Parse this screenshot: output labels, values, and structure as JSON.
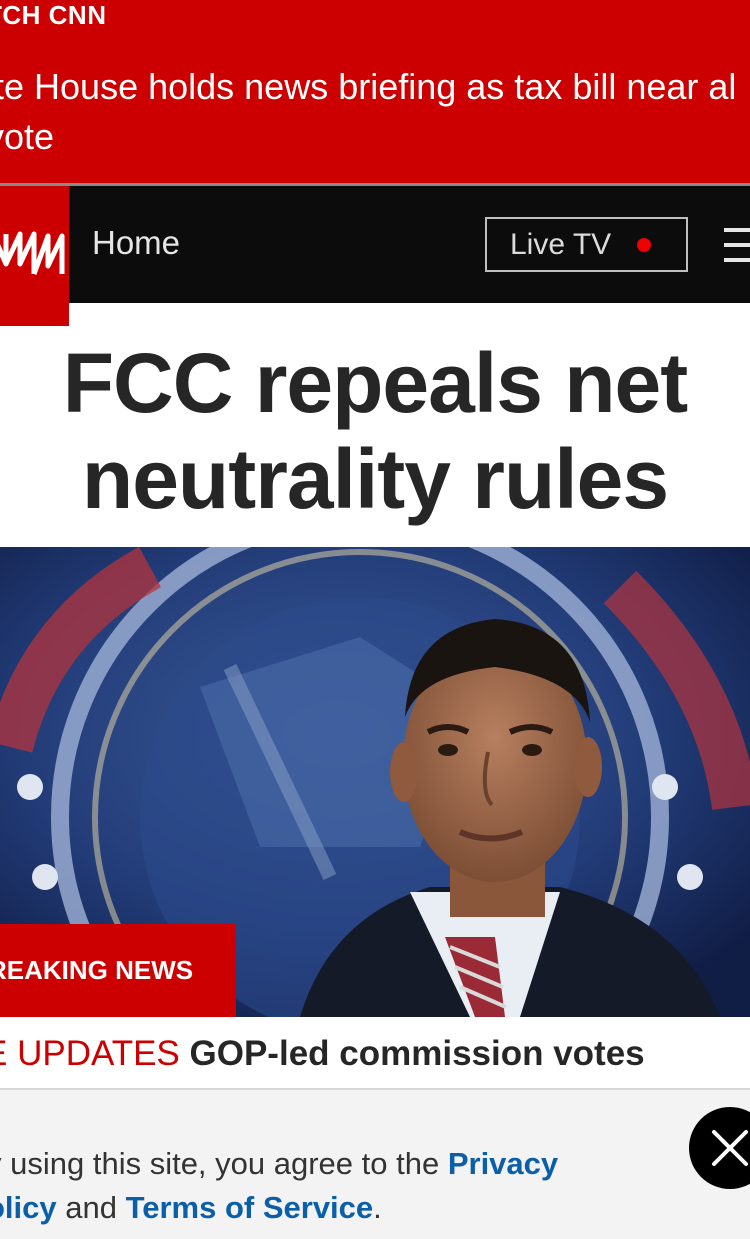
{
  "live_banner": {
    "label": "TCH CNN",
    "headline": "ite House holds news briefing as tax bill near al vote"
  },
  "nav": {
    "logo_text": "CNN",
    "home_label": "Home",
    "live_tv_label": "Live TV",
    "icons": [
      "cnn-logo-icon",
      "live-dot-icon",
      "hamburger-menu-icon"
    ]
  },
  "article": {
    "title": "FCC repeals net neutrality rules",
    "badge": "REAKING NEWS",
    "live_prefix": "E UPDATES",
    "summary": "GOP-led commission votes"
  },
  "privacy": {
    "text_before": "y using this site, you agree to the ",
    "privacy_link": "Privacy olicy",
    "text_middle": " and ",
    "terms_link": "Terms of Service",
    "text_after": "."
  },
  "colors": {
    "brand_red": "#cc0000",
    "nav_bg": "#0c0c0c",
    "link_blue": "#0b5ea8"
  }
}
